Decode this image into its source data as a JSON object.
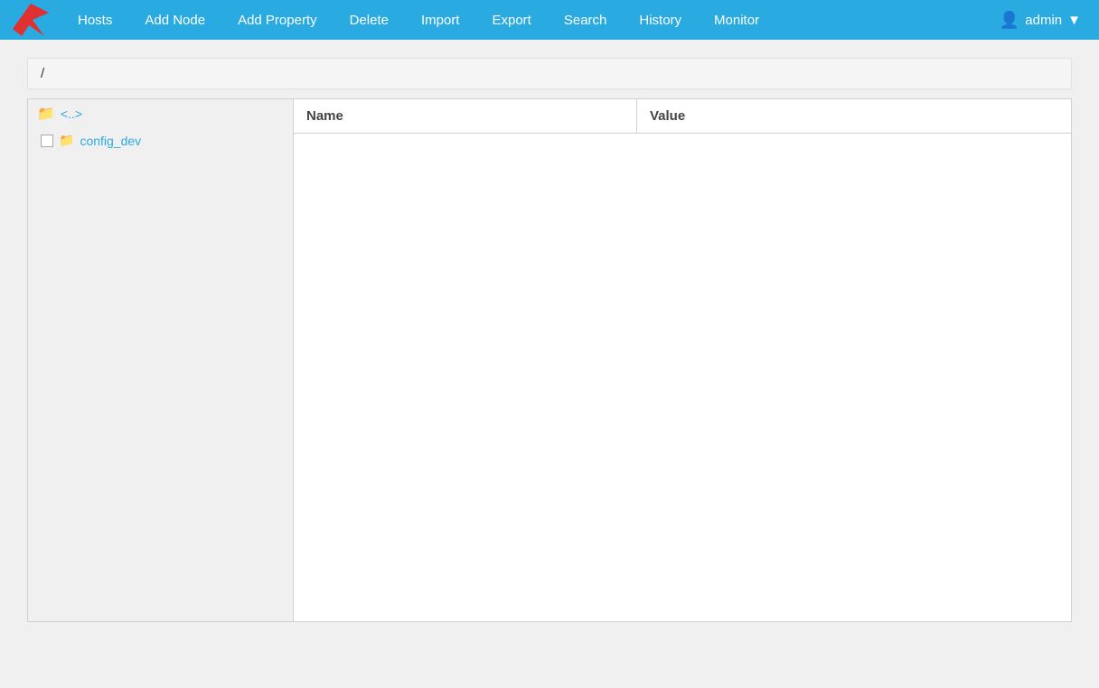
{
  "navbar": {
    "logo_alt": "Avi Networks",
    "items": [
      {
        "label": "Hosts",
        "id": "hosts"
      },
      {
        "label": "Add Node",
        "id": "add-node"
      },
      {
        "label": "Add Property",
        "id": "add-property"
      },
      {
        "label": "Delete",
        "id": "delete"
      },
      {
        "label": "Import",
        "id": "import"
      },
      {
        "label": "Export",
        "id": "export"
      },
      {
        "label": "Search",
        "id": "search"
      },
      {
        "label": "History",
        "id": "history"
      },
      {
        "label": "Monitor",
        "id": "monitor"
      }
    ],
    "user": {
      "label": "admin",
      "icon": "user-icon"
    }
  },
  "breadcrumb": {
    "path": "/"
  },
  "left_panel": {
    "root_item": {
      "label": "<..>",
      "icon": "folder-icon"
    },
    "child_items": [
      {
        "label": "config_dev",
        "icon": "folder-icon",
        "has_checkbox": true
      }
    ]
  },
  "right_panel": {
    "columns": [
      {
        "label": "Name",
        "id": "name"
      },
      {
        "label": "Value",
        "id": "value"
      }
    ],
    "rows": []
  }
}
